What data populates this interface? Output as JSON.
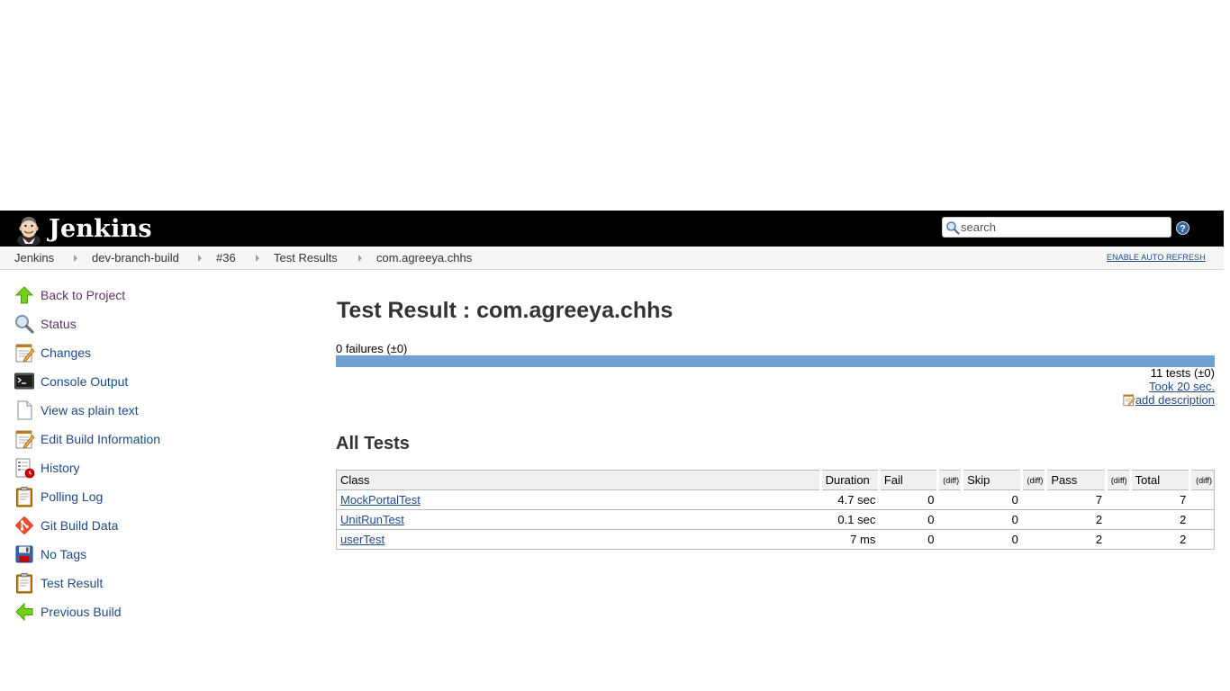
{
  "header": {
    "logo_text": "Jenkins",
    "search_placeholder": "search",
    "help_icon": "help-icon"
  },
  "breadcrumb": {
    "items": [
      "Jenkins",
      "dev-branch-build",
      "#36",
      "Test Results",
      "com.agreeya.chhs"
    ],
    "auto_refresh": "ENABLE AUTO REFRESH"
  },
  "sidebar": {
    "items": [
      {
        "label": "Back to Project",
        "icon": "up-arrow-icon"
      },
      {
        "label": "Status",
        "icon": "magnifier-icon"
      },
      {
        "label": "Changes",
        "icon": "notepad-icon"
      },
      {
        "label": "Console Output",
        "icon": "terminal-icon"
      },
      {
        "label": "View as plain text",
        "icon": "document-icon"
      },
      {
        "label": "Edit Build Information",
        "icon": "notepad-icon"
      },
      {
        "label": "History",
        "icon": "history-icon"
      },
      {
        "label": "Polling Log",
        "icon": "clipboard-icon"
      },
      {
        "label": "Git Build Data",
        "icon": "git-icon"
      },
      {
        "label": "No Tags",
        "icon": "save-icon"
      },
      {
        "label": "Test Result",
        "icon": "clipboard-icon"
      },
      {
        "label": "Previous Build",
        "icon": "left-arrow-icon"
      }
    ]
  },
  "main": {
    "title": "Test Result : com.agreeya.chhs",
    "failures": "0 failures (±0)",
    "fail_fraction": 0,
    "tests_count": "11 tests (±0)",
    "took": "Took 20 sec.",
    "add_description": "add description",
    "section_title": "All Tests",
    "table": {
      "headers": [
        "Class",
        "Duration",
        "Fail",
        "(diff)",
        "Skip",
        "(diff)",
        "Pass",
        "(diff)",
        "Total",
        "(diff)"
      ],
      "rows": [
        {
          "class": "MockPortalTest",
          "duration": "4.7 sec",
          "fail": "0",
          "skip": "0",
          "pass": "7",
          "total": "7"
        },
        {
          "class": "UnitRunTest",
          "duration": "0.1 sec",
          "fail": "0",
          "skip": "0",
          "pass": "2",
          "total": "2"
        },
        {
          "class": "userTest",
          "duration": "7 ms",
          "fail": "0",
          "skip": "0",
          "pass": "2",
          "total": "2"
        }
      ]
    }
  },
  "colors": {
    "header_bg": "#000000",
    "link": "#204a87",
    "visited_link": "#5c3566",
    "pass_bar": "#729fcf",
    "breadcrumb_bg": "#f6f7f4"
  }
}
